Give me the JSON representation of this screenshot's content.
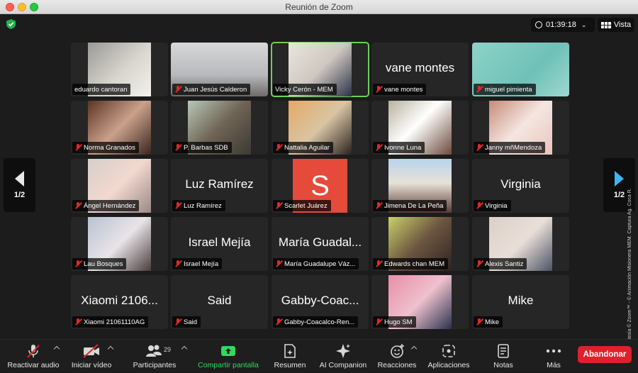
{
  "window": {
    "title": "Reunión de Zoom"
  },
  "header": {
    "timer": "01:39:18",
    "view_label": "Vista"
  },
  "pager": {
    "left_label": "1/2",
    "right_label": "1/2"
  },
  "watermark": "Cortesía © Zoom™ - © Animación Misionera MEM. Captura Ag. Coca R.",
  "participants": [
    {
      "name": "eduardo cantoran",
      "big": "",
      "muted": false,
      "bg": "linear-gradient(135deg,#9a9996,#d9d6cf 55%,#f3f1ec)"
    },
    {
      "name": "Juan Jesús Calderon",
      "big": "",
      "muted": true,
      "bg": "linear-gradient(180deg,#d8d8da,#b8b9bc 60%,#6e6a66)"
    },
    {
      "name": "Vicky Cerón - MEM",
      "big": "",
      "muted": false,
      "bg": "linear-gradient(135deg,#e9e6df,#cfc8c0 50%,#2c3348)"
    },
    {
      "name": "vane montes",
      "big": "vane montes",
      "muted": true,
      "bg": ""
    },
    {
      "name": "miguel pimienta",
      "big": "",
      "muted": true,
      "bg": "linear-gradient(135deg,#8fd2c9,#6fc1b7 60%,#9dd8cf)"
    },
    {
      "name": "Norma Granados",
      "big": "",
      "muted": true,
      "bg": "linear-gradient(135deg,#5b3426,#caa18a 50%,#3b2520)"
    },
    {
      "name": "P. Barbas SDB",
      "big": "",
      "muted": true,
      "bg": "linear-gradient(135deg,#b9c7b8,#6f6456 50%,#3c3a33)"
    },
    {
      "name": "Nattalia Aguilar",
      "big": "",
      "muted": true,
      "bg": "linear-gradient(135deg,#e5a866,#d9c5a4 50%,#2a2320)"
    },
    {
      "name": "Ivonne Luna",
      "big": "",
      "muted": true,
      "bg": "linear-gradient(135deg,#b7b29c,#fff 45%,#6c4a3c)"
    },
    {
      "name": "Janny mñMendoza",
      "big": "",
      "muted": true,
      "bg": "linear-gradient(135deg,#c88b78,#f4e6e2 50%,#e9c4bb)"
    },
    {
      "name": "Ángel Hernández",
      "big": "",
      "muted": true,
      "bg": "linear-gradient(135deg,#d6cfcb,#f2d8cf 50%,#9a8a85)"
    },
    {
      "name": "Luz Ramírez",
      "big": "Luz Ramírez",
      "muted": true,
      "bg": ""
    },
    {
      "name": "Scarlet Juárez",
      "big": "",
      "muted": true,
      "bg": "",
      "avatar": "S"
    },
    {
      "name": "Jimena De La Peña",
      "big": "",
      "muted": true,
      "bg": "linear-gradient(180deg,#b8d4ec,#e8e2d6 45%,#5a3a35)"
    },
    {
      "name": "Virginia",
      "big": "Virginia",
      "muted": true,
      "bg": ""
    },
    {
      "name": "Lau Bosques",
      "big": "",
      "muted": true,
      "bg": "linear-gradient(135deg,#b8c2d0,#e8e4e8 50%,#4a3d3c)"
    },
    {
      "name": "Israel Mejía",
      "big": "Israel Mejía",
      "muted": true,
      "bg": ""
    },
    {
      "name": "María Guadalupe Váz...",
      "big": "María Guadal...",
      "muted": true,
      "bg": ""
    },
    {
      "name": "Edwards chan MEM",
      "big": "",
      "muted": true,
      "bg": "linear-gradient(135deg,#c8d06a,#6b5540 50%,#2c2422)"
    },
    {
      "name": "Alexis Santiz",
      "big": "",
      "muted": true,
      "bg": "linear-gradient(135deg,#d9d0c8,#e9dfd8 50%,#4d5366)"
    },
    {
      "name": "Xiaomi 21061110AG",
      "big": "Xiaomi 2106...",
      "muted": true,
      "bg": ""
    },
    {
      "name": "Said",
      "big": "Said",
      "muted": true,
      "bg": ""
    },
    {
      "name": "Gabby-Coacalco-Ren...",
      "big": "Gabby-Coac...",
      "muted": true,
      "bg": ""
    },
    {
      "name": "Hugo SM",
      "big": "",
      "muted": true,
      "bg": "linear-gradient(135deg,#e98ea7,#efc0cd 50%,#2b3350)"
    },
    {
      "name": "Mike",
      "big": "Mike",
      "muted": true,
      "bg": ""
    }
  ],
  "toolbar": {
    "audio": "Reactivar audio",
    "video": "Iniciar vídeo",
    "participants": "Participantes",
    "participants_count": "29",
    "share": "Compartir pantalla",
    "summary": "Resumen",
    "ai": "AI Companion",
    "reactions": "Reacciones",
    "apps": "Aplicaciones",
    "notes": "Notas",
    "more": "Más",
    "leave": "Abandonar"
  },
  "colors": {
    "active_speaker": "#6bd05a",
    "share_green": "#2ddc5c",
    "leave_red": "#e0202b",
    "avatar_red": "#e64a3b"
  }
}
